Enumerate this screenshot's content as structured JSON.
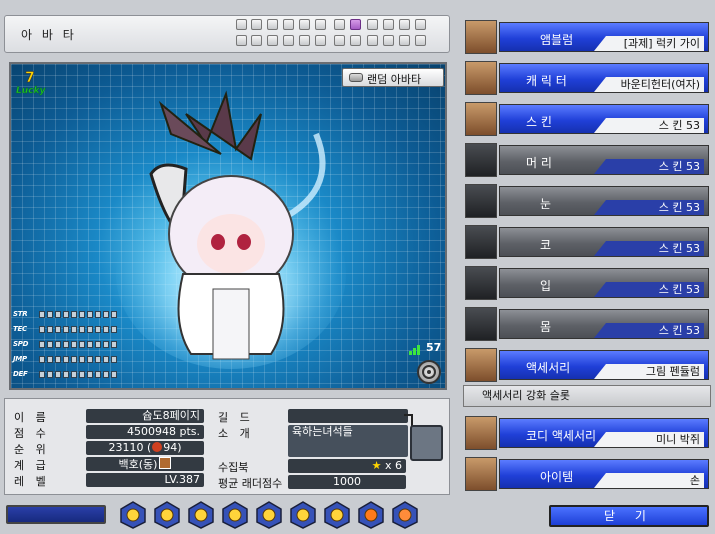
{
  "header": {
    "title": "아 바 타",
    "slots_row1": [
      false,
      false,
      false,
      false,
      false,
      false,
      false,
      true,
      false,
      false,
      false,
      false
    ],
    "slots_row2": [
      false,
      false,
      false,
      false,
      false,
      false,
      false,
      false,
      false,
      false,
      false,
      false
    ]
  },
  "viewport": {
    "random_avatar_label": "랜덤 아바타",
    "stats": [
      {
        "name": "STR",
        "level": 0
      },
      {
        "name": "TEC",
        "level": 0
      },
      {
        "name": "SPD",
        "level": 0
      },
      {
        "name": "JMP",
        "level": 0
      },
      {
        "name": "DEF",
        "level": 0
      }
    ],
    "signal_value": "57",
    "logo_text": "Lucky",
    "logo_number": "7"
  },
  "info": {
    "name_label": "이 름",
    "name_value": "슙도8페이지",
    "score_label": "점 수",
    "score_value": "4500948 pts.",
    "rank_label": "순 위",
    "rank_value": "23110 (",
    "rank_change": "94)",
    "class_label": "계 급",
    "class_value": "백호(동)",
    "level_label": "레 벨",
    "level_value": "LV.387",
    "guild_label": "길 드",
    "guild_value": "",
    "intro_label": "소 개",
    "intro_value": "육하는녀석들",
    "collection_label": "수집북",
    "collection_value": "x 6",
    "ladder_label": "평균 래더점수",
    "ladder_value": "1000"
  },
  "menu": [
    {
      "label": "앰블럼",
      "value": "[과제] 럭키 가이",
      "style": "blue",
      "thumb": "lucky-emblem-icon"
    },
    {
      "label": "캐 릭 터",
      "value": "바운티헌터(여자)",
      "style": "blue",
      "thumb": "character-portrait-icon"
    },
    {
      "label": "스   킨",
      "value": "스   킨 53",
      "style": "blue",
      "thumb": "skin-icon"
    },
    {
      "label": "머   리",
      "value": "스   킨 53",
      "style": "gray",
      "thumb": "hair-icon"
    },
    {
      "label": "눈",
      "value": "스   킨 53",
      "style": "gray",
      "thumb": "eyes-icon"
    },
    {
      "label": "코",
      "value": "스   킨 53",
      "style": "gray",
      "thumb": "nose-icon"
    },
    {
      "label": "입",
      "value": "스   킨 53",
      "style": "gray",
      "thumb": "mouth-icon"
    },
    {
      "label": "몸",
      "value": "스   킨 53",
      "style": "gray",
      "thumb": "body-icon"
    },
    {
      "label": "액세서리",
      "value": "그림 펜듈럼",
      "style": "blue",
      "thumb": "accessory-icon"
    }
  ],
  "enhance_slot_label": "액세서리 강화 슬롯",
  "menu2": [
    {
      "label": "코디 액세서리",
      "value": "미니 박쥐",
      "style": "blue",
      "thumb": "codi-accessory-icon"
    },
    {
      "label": "아이템",
      "value": "손",
      "style": "blue",
      "thumb": "item-hand-icon"
    }
  ],
  "toolbar": {
    "tools": [
      "pin-tool-icon",
      "chat-tool-icon",
      "card-tool-icon",
      "pocket-tool-icon",
      "star-tool-icon",
      "bag-tool-icon",
      "bell-tool-icon",
      "chart-tool-icon",
      "note-tool-icon"
    ],
    "close_label": "닫 기"
  },
  "colors": {
    "accent_blue": "#2040d8",
    "panel_gray": "#e6e7ea",
    "dark_field": "#333a42"
  }
}
